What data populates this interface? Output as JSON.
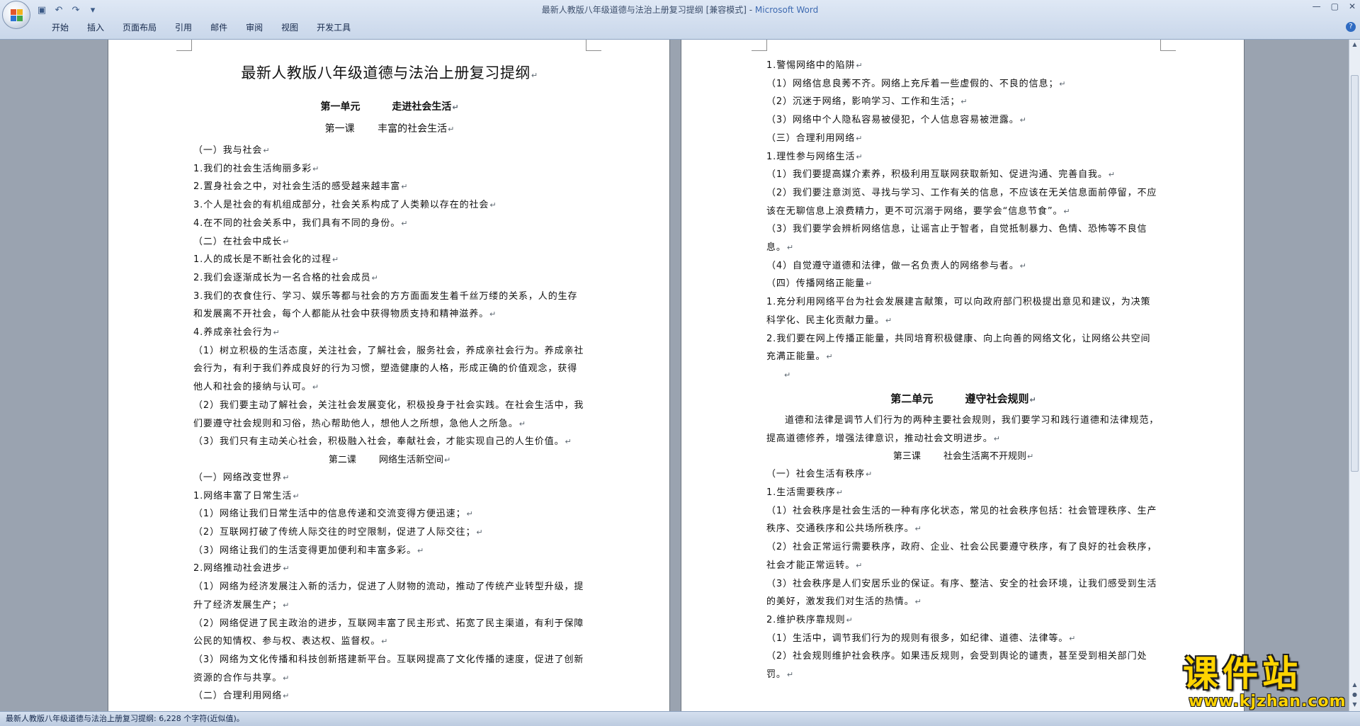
{
  "window": {
    "title_doc": "最新人教版八年级道德与法治上册复习提纲 [兼容模式] - ",
    "title_app": "Microsoft Word",
    "controls": [
      "—",
      "▢",
      "✕"
    ]
  },
  "ribbon": {
    "tabs": [
      "开始",
      "插入",
      "页面布局",
      "引用",
      "邮件",
      "审阅",
      "视图",
      "开发工具"
    ]
  },
  "left_page": {
    "title": "最新人教版八年级道德与法治上册复习提纲",
    "unit1": "第一单元 走进社会生活",
    "lesson1": "第一课 丰富的社会生活",
    "block1": [
      "（一）我与社会",
      "1.我们的社会生活绚丽多彩",
      "2.置身社会之中，对社会生活的感受越来越丰富",
      "3.个人是社会的有机组成部分，社会关系构成了人类赖以存在的社会",
      "4.在不同的社会关系中，我们具有不同的身份。",
      "（二）在社会中成长",
      "1.人的成长是不断社会化的过程",
      "2.我们会逐渐成长为一名合格的社会成员",
      "3.我们的衣食住行、学习、娱乐等都与社会的方方面面发生着千丝万缕的关系，人的生存和发展离不开社会，每个人都能从社会中获得物质支持和精神滋养。",
      "4.养成亲社会行为",
      "（1）树立积极的生活态度，关注社会，了解社会，服务社会，养成亲社会行为。养成亲社会行为，有利于我们养成良好的行为习惯，塑造健康的人格，形成正确的价值观念，获得他人和社会的接纳与认可。",
      "（2）我们要主动了解社会，关注社会发展变化，积极投身于社会实践。在社会生活中，我们要遵守社会规则和习俗，热心帮助他人，想他人之所想，急他人之所急。",
      "（3）我们只有主动关心社会，积极融入社会，奉献社会，才能实现自己的人生价值。"
    ],
    "lesson2": "第二课 网络生活新空间",
    "block2": [
      "（一）网络改变世界",
      "1.网络丰富了日常生活",
      "（1）网络让我们日常生活中的信息传递和交流变得方便迅速；",
      "（2）互联网打破了传统人际交往的时空限制，促进了人际交往；",
      "（3）网络让我们的生活变得更加便利和丰富多彩。",
      "2.网络推动社会进步",
      "（1）网络为经济发展注入新的活力，促进了人财物的流动，推动了传统产业转型升级，提升了经济发展生产；",
      "（2）网络促进了民主政治的进步，互联网丰富了民主形式、拓宽了民主渠道，有利于保障公民的知情权、参与权、表达权、监督权。",
      "（3）网络为文化传播和科技创新搭建新平台。互联网提高了文化传播的速度，促进了创新资源的合作与共享。",
      "（二）合理利用网络"
    ]
  },
  "right_page": {
    "block1": [
      "1.警惕网络中的陷阱",
      "（1）网络信息良莠不齐。网络上充斥着一些虚假的、不良的信息；",
      "（2）沉迷于网络，影响学习、工作和生活；",
      "（3）网络中个人隐私容易被侵犯，个人信息容易被泄露。",
      "（三）合理利用网络",
      "1.理性参与网络生活",
      "（1）我们要提高媒介素养，积极利用互联网获取新知、促进沟通、完善自我。",
      "（2）我们要注意浏览、寻找与学习、工作有关的信息，不应该在无关信息面前停留，不应该在无聊信息上浪费精力，更不可沉溺于网络，要学会“信息节食”。",
      "（3）我们要学会辨析网络信息，让谣言止于智者，自觉抵制暴力、色情、恐怖等不良信息。",
      "（4）自觉遵守道德和法律，做一名负责人的网络参与者。",
      "（四）传播网络正能量",
      "1.充分利用网络平台为社会发展建言献策，可以向政府部门积极提出意见和建议，为决策科学化、民主化贡献力量。",
      "2.我们要在网上传播正能量，共同培育积极健康、向上向善的网络文化，让网络公共空间充满正能量。"
    ],
    "unit2": "第二单元 遵守社会规则",
    "intro": "道德和法律是调节人们行为的两种主要社会规则，我们要学习和践行道德和法律规范，提高道德修养，增强法律意识，推动社会文明进步。",
    "lesson3": "第三课 社会生活离不开规则",
    "block2": [
      "（一）社会生活有秩序",
      "1.生活需要秩序",
      "（1）社会秩序是社会生活的一种有序化状态，常见的社会秩序包括：社会管理秩序、生产秩序、交通秩序和公共场所秩序。",
      "（2）社会正常运行需要秩序，政府、企业、社会公民要遵守秩序，有了良好的社会秩序，社会才能正常运转。",
      "（3）社会秩序是人们安居乐业的保证。有序、整洁、安全的社会环境，让我们感受到生活的美好，激发我们对生活的热情。",
      "2.维护秩序靠规则",
      "（1）生活中，调节我们行为的规则有很多，如纪律、道德、法律等。",
      "（2）社会规则维护社会秩序。如果违反规则，会受到舆论的谴责，甚至受到相关部门处罚。"
    ]
  },
  "status": {
    "text": "最新人教版八年级道德与法治上册复习提纲: 6,228 个字符(近似值)。"
  },
  "watermark": {
    "title": "课件站",
    "url": "www.kjzhan.com"
  },
  "paragraph_mark": "↵"
}
